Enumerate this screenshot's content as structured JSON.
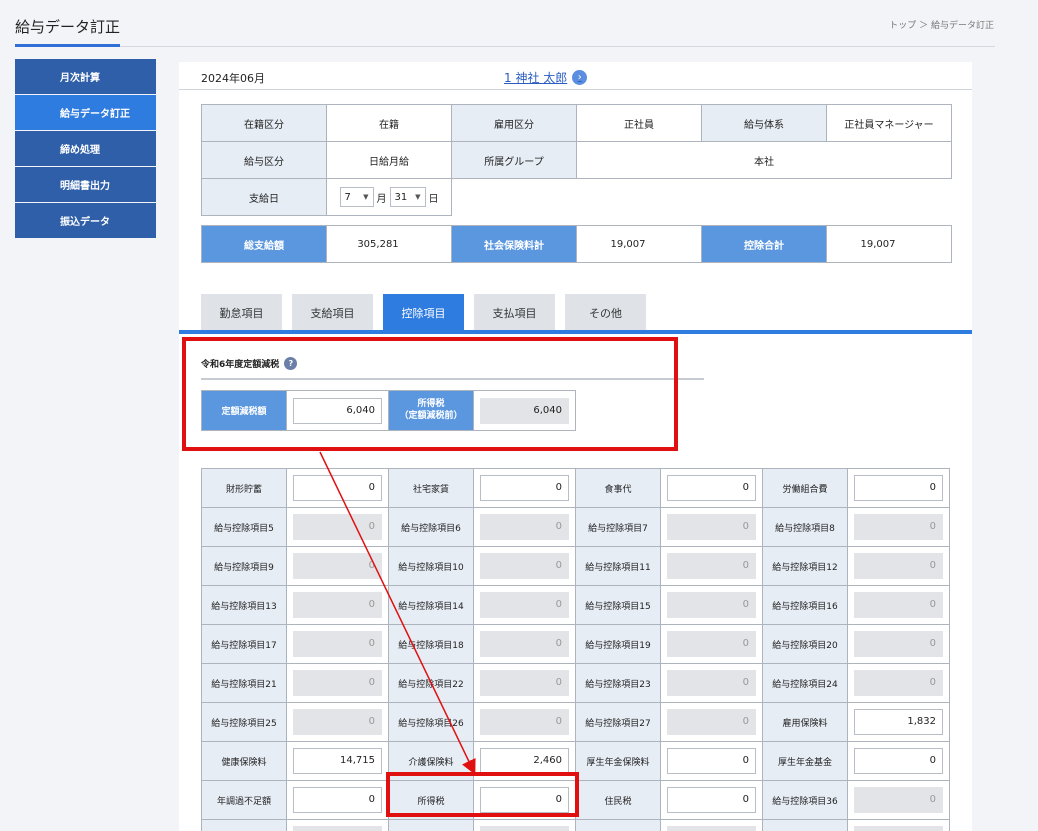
{
  "header": {
    "title": "給与データ訂正",
    "breadcrumb": "トップ ＞ 給与データ訂正"
  },
  "sidebar": {
    "items": [
      {
        "label": "月次計算",
        "active": false
      },
      {
        "label": "給与データ訂正",
        "active": true
      },
      {
        "label": "締め処理",
        "active": false
      },
      {
        "label": "明細書出力",
        "active": false
      },
      {
        "label": "振込データ",
        "active": false
      }
    ]
  },
  "period": {
    "month": "2024年06月"
  },
  "employee": {
    "name": "1 神社 太郎",
    "go_icon": "chevron-right-icon"
  },
  "info": {
    "enrollment_label": "在籍区分",
    "enrollment_value": "在籍",
    "employment_label": "雇用区分",
    "employment_value": "正社員",
    "pay_system_label": "給与体系",
    "pay_system_value": "正社員マネージャー",
    "pay_type_label": "給与区分",
    "pay_type_value": "日給月給",
    "group_label": "所属グループ",
    "group_value": "本社",
    "payday_label": "支給日",
    "payday_month": "7",
    "payday_month_unit": "月",
    "payday_day": "31",
    "payday_day_unit": "日"
  },
  "totals": {
    "gross_label": "総支給額",
    "gross_value": "305,281",
    "social_label": "社会保険料計",
    "social_value": "19,007",
    "deduction_label": "控除合計",
    "deduction_value": "19,007"
  },
  "tabs": [
    {
      "label": "勤怠項目",
      "active": false
    },
    {
      "label": "支給項目",
      "active": false
    },
    {
      "label": "控除項目",
      "active": true
    },
    {
      "label": "支払項目",
      "active": false
    },
    {
      "label": "その他",
      "active": false
    }
  ],
  "tax_reduction": {
    "title": "令和6年度定額減税",
    "amount_label": "定額減税額",
    "amount_value": "6,040",
    "income_tax_label_1": "所得税",
    "income_tax_label_2": "（定額減税前）",
    "income_tax_value": "6,040"
  },
  "deductions": [
    [
      {
        "label": "財形貯蓄",
        "value": "0",
        "editable": true
      },
      {
        "label": "社宅家賃",
        "value": "0",
        "editable": true
      },
      {
        "label": "食事代",
        "value": "0",
        "editable": true
      },
      {
        "label": "労働組合費",
        "value": "0",
        "editable": true
      }
    ],
    [
      {
        "label": "給与控除項目5",
        "value": "0",
        "editable": false
      },
      {
        "label": "給与控除項目6",
        "value": "0",
        "editable": false
      },
      {
        "label": "給与控除項目7",
        "value": "0",
        "editable": false
      },
      {
        "label": "給与控除項目8",
        "value": "0",
        "editable": false
      }
    ],
    [
      {
        "label": "給与控除項目9",
        "value": "0",
        "editable": false
      },
      {
        "label": "給与控除項目10",
        "value": "0",
        "editable": false
      },
      {
        "label": "給与控除項目11",
        "value": "0",
        "editable": false
      },
      {
        "label": "給与控除項目12",
        "value": "0",
        "editable": false
      }
    ],
    [
      {
        "label": "給与控除項目13",
        "value": "0",
        "editable": false
      },
      {
        "label": "給与控除項目14",
        "value": "0",
        "editable": false
      },
      {
        "label": "給与控除項目15",
        "value": "0",
        "editable": false
      },
      {
        "label": "給与控除項目16",
        "value": "0",
        "editable": false
      }
    ],
    [
      {
        "label": "給与控除項目17",
        "value": "0",
        "editable": false
      },
      {
        "label": "給与控除項目18",
        "value": "0",
        "editable": false
      },
      {
        "label": "給与控除項目19",
        "value": "0",
        "editable": false
      },
      {
        "label": "給与控除項目20",
        "value": "0",
        "editable": false
      }
    ],
    [
      {
        "label": "給与控除項目21",
        "value": "0",
        "editable": false
      },
      {
        "label": "給与控除項目22",
        "value": "0",
        "editable": false
      },
      {
        "label": "給与控除項目23",
        "value": "0",
        "editable": false
      },
      {
        "label": "給与控除項目24",
        "value": "0",
        "editable": false
      }
    ],
    [
      {
        "label": "給与控除項目25",
        "value": "0",
        "editable": false
      },
      {
        "label": "給与控除項目26",
        "value": "0",
        "editable": false
      },
      {
        "label": "給与控除項目27",
        "value": "0",
        "editable": false
      },
      {
        "label": "雇用保険料",
        "value": "1,832",
        "editable": true
      }
    ],
    [
      {
        "label": "健康保険料",
        "value": "14,715",
        "editable": true
      },
      {
        "label": "介護保険料",
        "value": "2,460",
        "editable": true
      },
      {
        "label": "厚生年金保険料",
        "value": "0",
        "editable": true
      },
      {
        "label": "厚生年金基金",
        "value": "0",
        "editable": true
      }
    ],
    [
      {
        "label": "年調過不足額",
        "value": "0",
        "editable": true
      },
      {
        "label": "所得税",
        "value": "0",
        "editable": true
      },
      {
        "label": "住民税",
        "value": "0",
        "editable": true
      },
      {
        "label": "給与控除項目36",
        "value": "0",
        "editable": false
      }
    ],
    [
      {
        "label": "",
        "value": "",
        "editable": false
      },
      {
        "label": "",
        "value": "",
        "editable": false
      },
      {
        "label": "",
        "value": "",
        "editable": false
      },
      {
        "label": "",
        "value": "",
        "editable": false
      }
    ]
  ],
  "annotation": {
    "color": "#e01010"
  }
}
